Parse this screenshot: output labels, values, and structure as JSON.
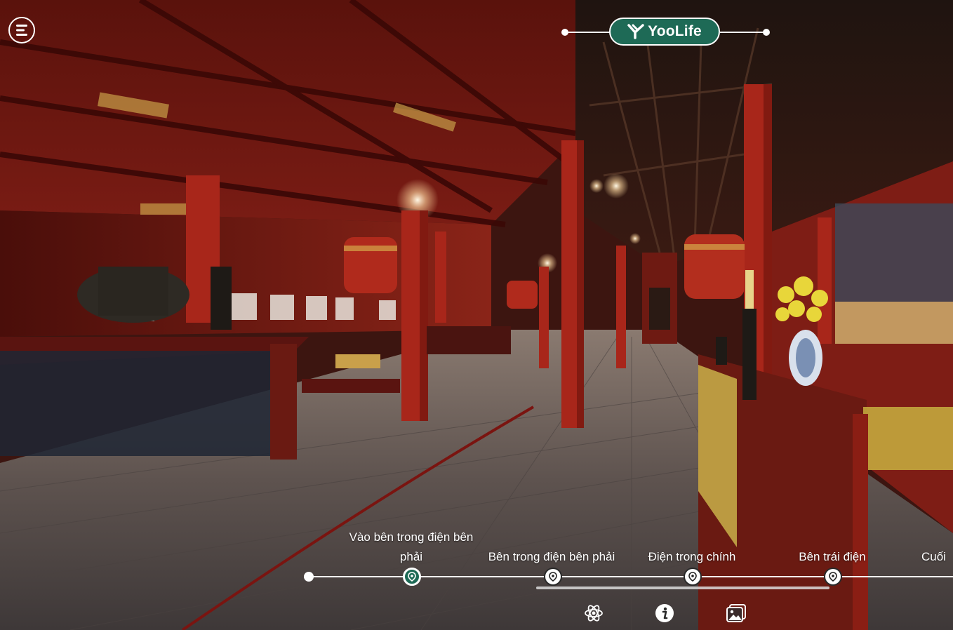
{
  "brand": {
    "name": "YooLife",
    "accent_color": "#1e6a56"
  },
  "menu": {
    "icon": "hamburger-menu-icon"
  },
  "timeline": {
    "scenes": [
      {
        "label": "Vào bên trong điện bên\nphải",
        "active": true
      },
      {
        "label": "Bên trong điện bên phải",
        "active": false
      },
      {
        "label": "Điện trong chính",
        "active": false
      },
      {
        "label": "Bên trái điện",
        "active": false
      },
      {
        "label": "Cuối",
        "active": false
      }
    ]
  },
  "toolbar": {
    "icons": [
      "atom-icon",
      "info-icon",
      "gallery-icon"
    ]
  }
}
